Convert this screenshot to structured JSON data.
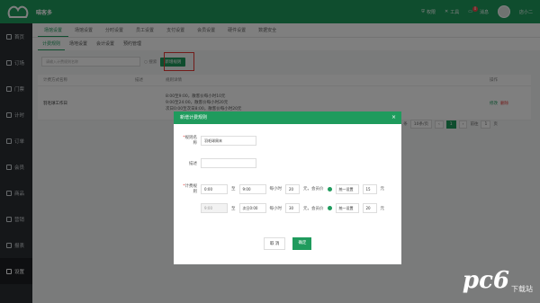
{
  "header": {
    "brand": "喵客多",
    "items": [
      {
        "icon": "shield-icon",
        "label": "权限"
      },
      {
        "icon": "tool-icon",
        "label": "工具"
      },
      {
        "icon": "chat-icon",
        "label": "消息",
        "badge": "0"
      }
    ],
    "user": "店小二"
  },
  "sidebar": {
    "items": [
      {
        "label": "首页"
      },
      {
        "label": "订场"
      },
      {
        "label": "门票"
      },
      {
        "label": "计时"
      },
      {
        "label": "订单"
      },
      {
        "label": "会员"
      },
      {
        "label": "商品"
      },
      {
        "label": "营销"
      },
      {
        "label": "报表"
      },
      {
        "label": "设置",
        "active": true
      }
    ]
  },
  "tabs": [
    {
      "label": "场馆设置",
      "active": true
    },
    {
      "label": "场馆设置"
    },
    {
      "label": "分时设置"
    },
    {
      "label": "员工设置"
    },
    {
      "label": "支付设置"
    },
    {
      "label": "会员设置"
    },
    {
      "label": "硬件设置"
    },
    {
      "label": "数据安全"
    }
  ],
  "subtabs": [
    {
      "label": "计费规则",
      "active": true
    },
    {
      "label": "场地设置"
    },
    {
      "label": "会计设置"
    },
    {
      "label": "预约管理"
    }
  ],
  "toolbar": {
    "search_placeholder": "请输入计费规则名称",
    "search_label": "搜索",
    "new_label": "新增规则"
  },
  "table": {
    "headers": [
      "计费方式名称",
      "描述",
      "规则详情",
      "操作"
    ],
    "rows": [
      {
        "name": "羽毛球工作日",
        "desc": "",
        "rules": [
          "8:00至9:00，散客价每小时10元",
          "9:00至24:00，散客价每小时20元",
          "次日0:00至次日8:00，散客价每小时20元"
        ],
        "edit": "修改",
        "delete": "删除"
      }
    ]
  },
  "pager": {
    "total": "共 1 条",
    "per_page": "10条/页",
    "current": "1",
    "goto_label": "前往",
    "goto_value": "1",
    "pages_unit": "页"
  },
  "modal": {
    "title": "新增计费规则",
    "name_label": "规则名称",
    "name_value": "羽毛球周末",
    "desc_label": "描述",
    "desc_value": "",
    "rule_label": "计费规则",
    "row1": {
      "from": "0:00",
      "to_word": "至",
      "to": "9:00",
      "per": "每小时",
      "price": "20",
      "yuan_member": "元，会员价",
      "select": "统一设置",
      "member_price": "15",
      "yuan": "元"
    },
    "row2": {
      "from": "9:00",
      "to_word": "至",
      "to": "次日0:00",
      "per": "每小时",
      "price": "30",
      "yuan_member": "元，会员价",
      "select": "统一设置",
      "member_price": "20",
      "yuan": "元"
    },
    "cancel": "取 消",
    "ok": "确定"
  },
  "watermark": {
    "logo": "pc6",
    "text": "下载站"
  }
}
